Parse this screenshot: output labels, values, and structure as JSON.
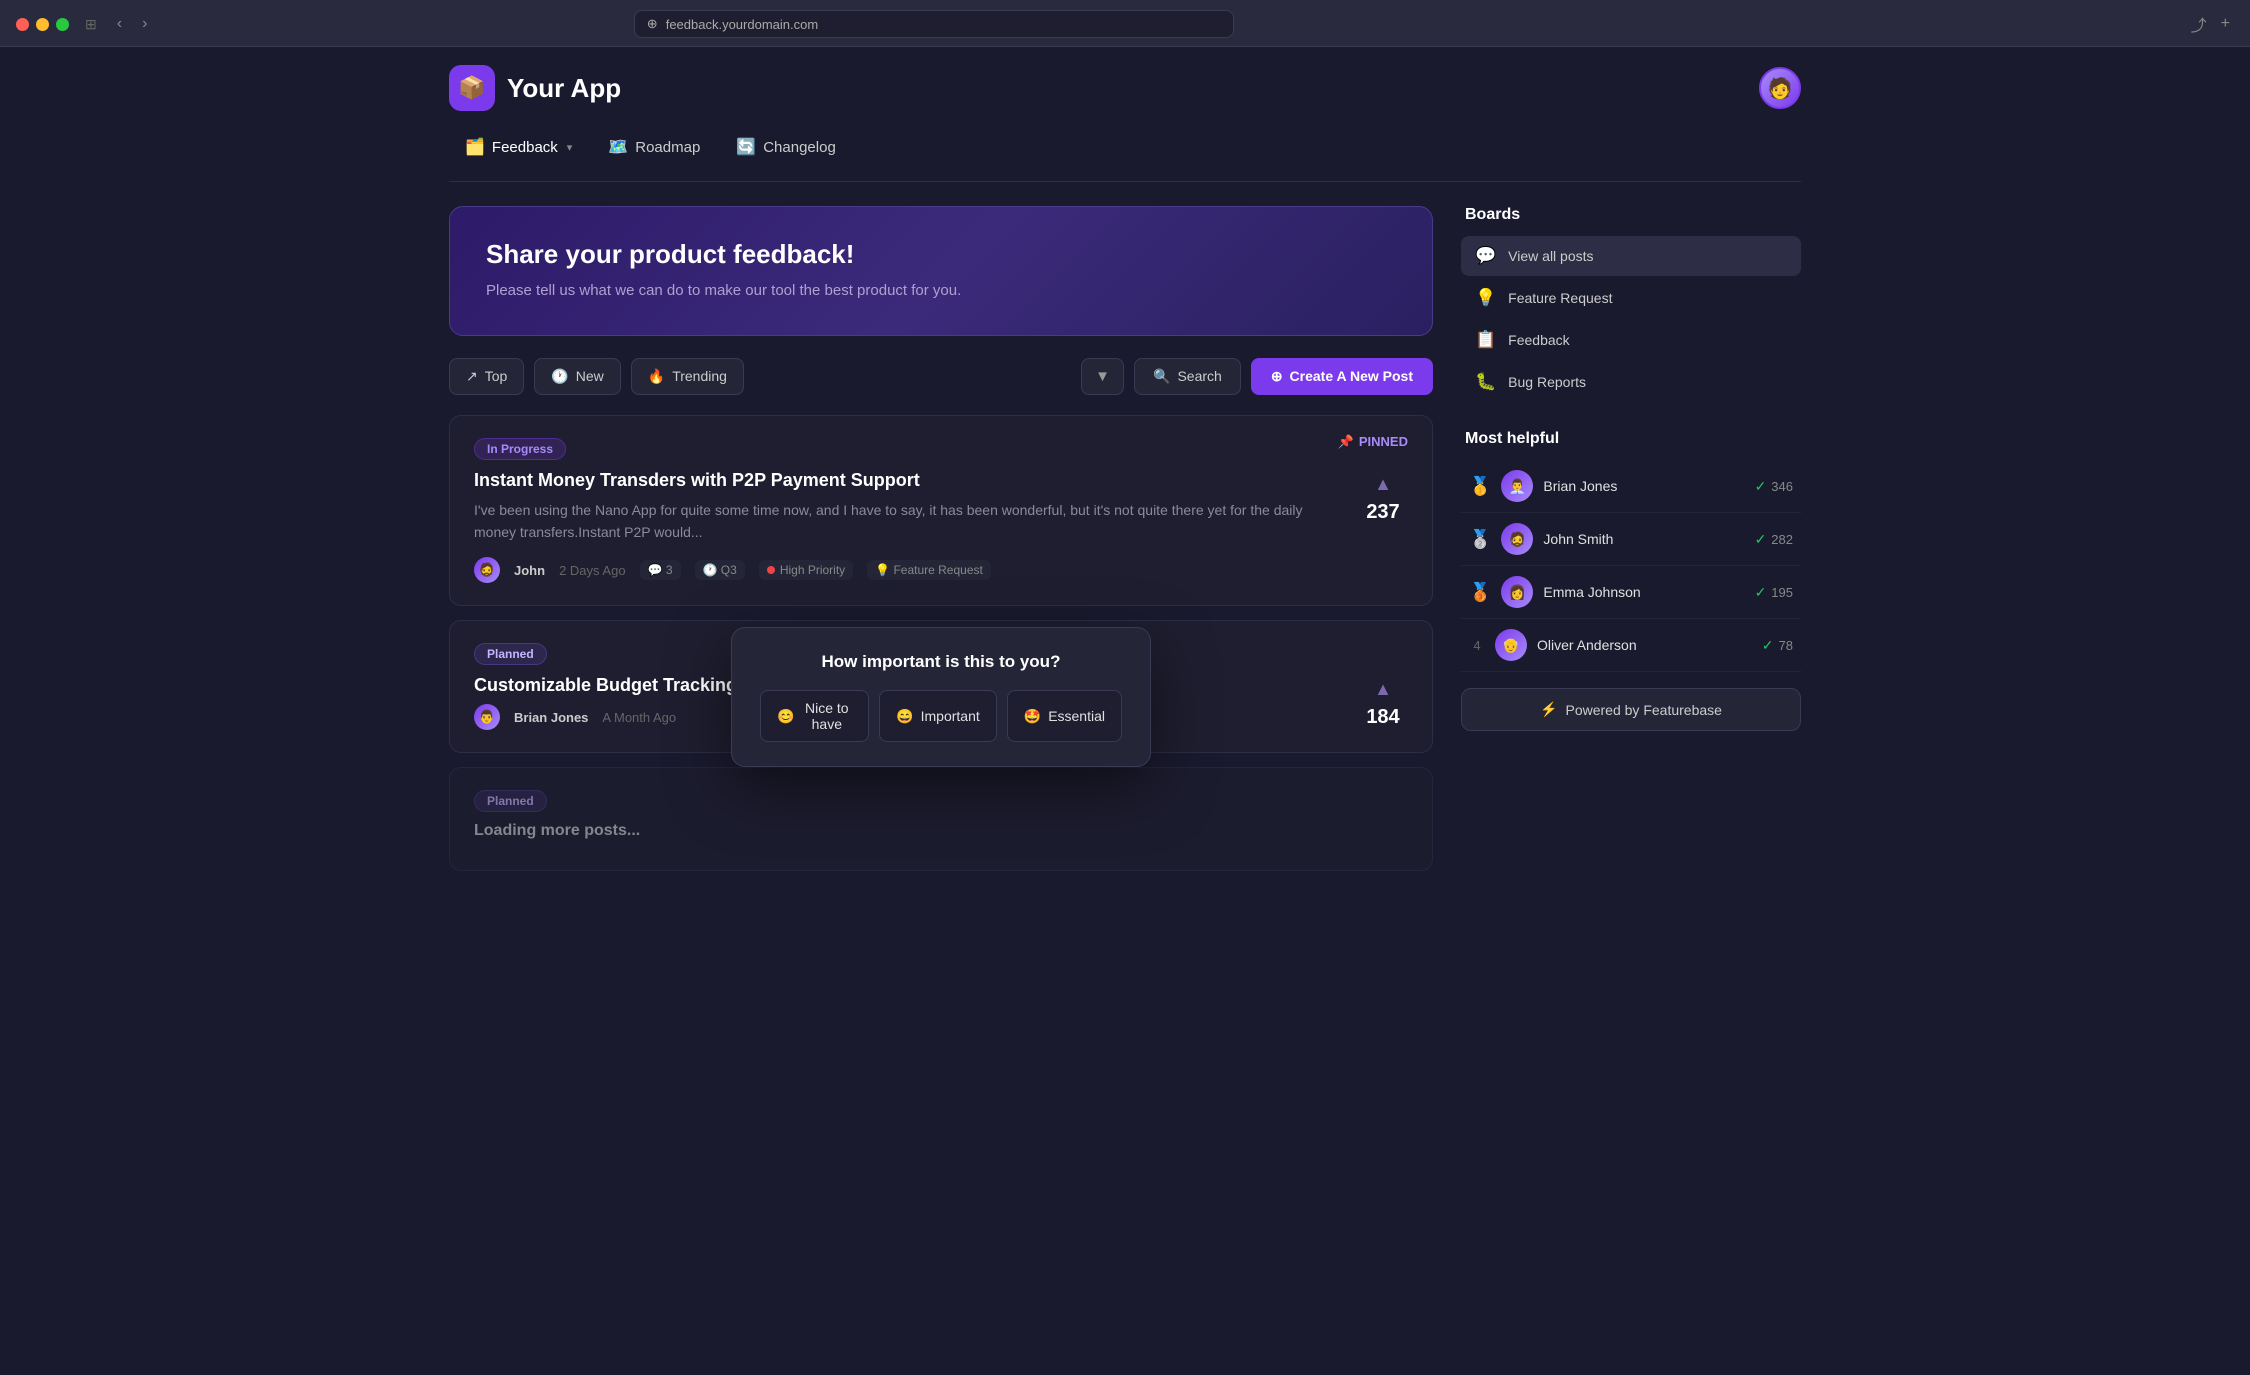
{
  "browser": {
    "url": "feedback.yourdomain.com"
  },
  "app": {
    "logo_icon": "📦",
    "title": "Your App"
  },
  "nav": {
    "items": [
      {
        "id": "feedback",
        "icon": "🗂️",
        "label": "Feedback",
        "active": true,
        "has_chevron": true
      },
      {
        "id": "roadmap",
        "icon": "🗺️",
        "label": "Roadmap",
        "active": false,
        "has_chevron": false
      },
      {
        "id": "changelog",
        "icon": "🔄",
        "label": "Changelog",
        "active": false,
        "has_chevron": false
      }
    ]
  },
  "hero": {
    "title": "Share your product feedback!",
    "subtitle": "Please tell us what we can do to make our tool the best product for you."
  },
  "action_bar": {
    "tabs": [
      {
        "id": "top",
        "icon": "↗",
        "label": "Top"
      },
      {
        "id": "new",
        "icon": "🕐",
        "label": "New"
      },
      {
        "id": "trending",
        "icon": "🔥",
        "label": "Trending"
      }
    ],
    "filter_icon": "▼",
    "search_label": "Search",
    "create_label": "Create A New Post",
    "create_icon": "+"
  },
  "posts": [
    {
      "id": "post-1",
      "pinned": true,
      "pinned_label": "📌 PINNED",
      "status": "In Progress",
      "status_type": "in-progress",
      "title": "Instant Money Transders with P2P Payment Support",
      "excerpt": "I've been using the Nano App for quite some time now, and I have to say, it has been wonderful, but it's not quite there yet for the daily money transfers.Instant P2P would...",
      "author": "John",
      "author_emoji": "🧔",
      "time": "2 Days Ago",
      "comments": "3",
      "quarter": "Q3",
      "priority": "High Priority",
      "tag": "Feature Request",
      "votes": "237"
    },
    {
      "id": "post-2",
      "pinned": false,
      "status": "Planned",
      "status_type": "planned",
      "title": "Customizable Budget Tracking for Pers",
      "excerpt": "",
      "author": "Brian Jones",
      "author_emoji": "👨",
      "time": "A Month Ago",
      "votes": "184"
    }
  ],
  "importance_popup": {
    "title": "How important is this to you?",
    "options": [
      {
        "id": "nice-to-have",
        "emoji": "😊",
        "label": "Nice to have"
      },
      {
        "id": "important",
        "emoji": "😄",
        "label": "Important"
      },
      {
        "id": "essential",
        "emoji": "🤩",
        "label": "Essential"
      }
    ]
  },
  "sidebar": {
    "boards_title": "Boards",
    "boards": [
      {
        "id": "view-all",
        "icon": "💬",
        "label": "View all posts",
        "active": true
      },
      {
        "id": "feature-request",
        "icon": "💡",
        "label": "Feature Request",
        "active": false
      },
      {
        "id": "feedback",
        "icon": "📋",
        "label": "Feedback",
        "active": false
      },
      {
        "id": "bug-reports",
        "icon": "🐛",
        "label": "Bug Reports",
        "active": false
      }
    ],
    "helpful_title": "Most helpful",
    "helpful_users": [
      {
        "rank": "",
        "medal": "🥇",
        "name": "Brian Jones",
        "score": "346"
      },
      {
        "rank": "",
        "medal": "🥈",
        "name": "John Smith",
        "score": "282"
      },
      {
        "rank": "",
        "medal": "🥉",
        "name": "Emma Johnson",
        "score": "195"
      },
      {
        "rank": "4",
        "medal": "",
        "name": "Oliver Anderson",
        "score": "78"
      }
    ],
    "powered_by": "Powered by Featurebase",
    "powered_icon": "⚡"
  }
}
